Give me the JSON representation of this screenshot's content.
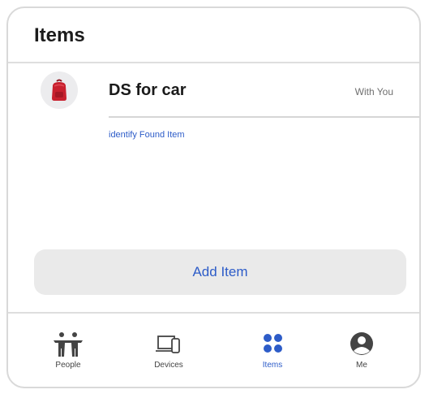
{
  "header": {
    "title": "Items"
  },
  "items": [
    {
      "name": "DS for car",
      "status": "With You",
      "icon": "red-backpack-icon"
    }
  ],
  "identify_link": "identify Found Item",
  "add_item_label": "Add Item",
  "tabs": [
    {
      "label": "People",
      "icon": "people-icon",
      "active": false
    },
    {
      "label": "Devices",
      "icon": "devices-icon",
      "active": false
    },
    {
      "label": "Items",
      "icon": "items-grid-icon",
      "active": true
    },
    {
      "label": "Me",
      "icon": "person-circle-icon",
      "active": false
    }
  ],
  "colors": {
    "accent": "#2d5cc8",
    "item_icon": "#c8202e",
    "button_bg": "#eaeaea"
  }
}
